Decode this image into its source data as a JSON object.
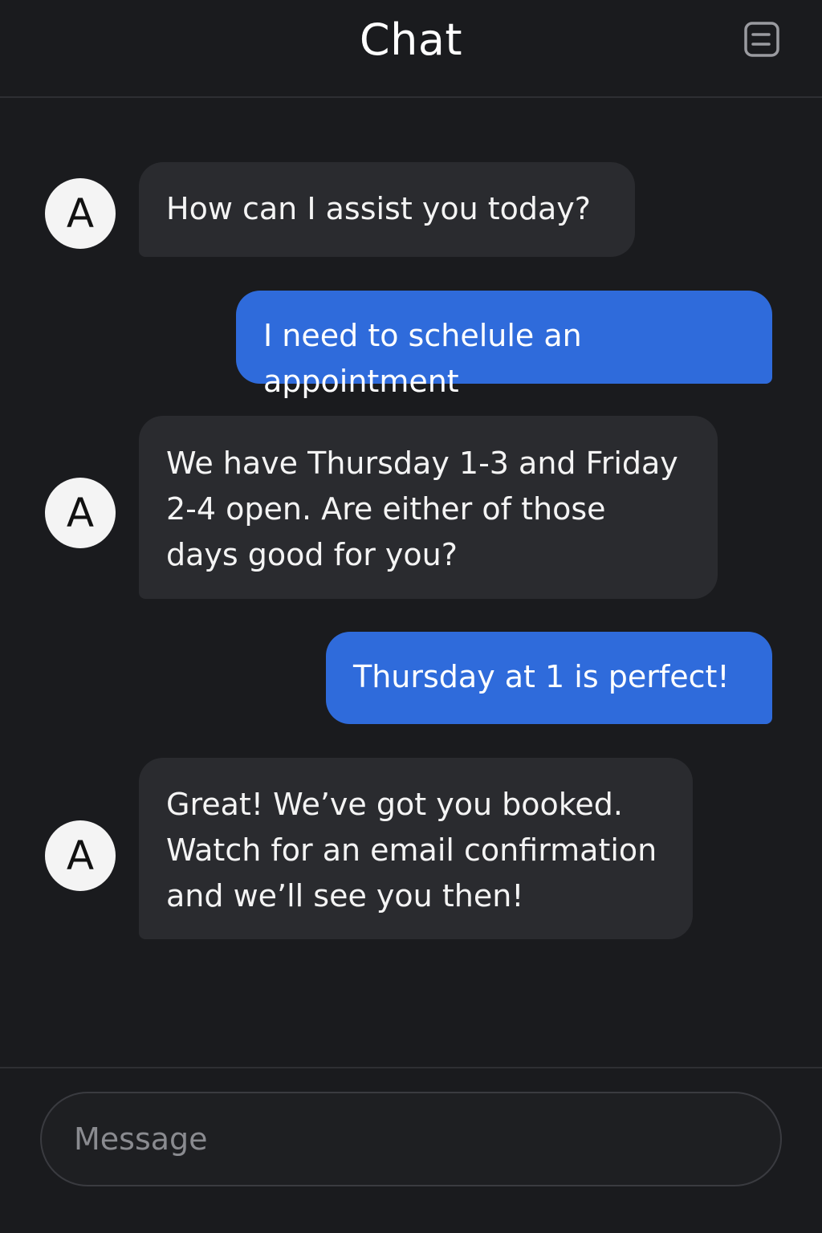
{
  "header": {
    "title": "Chat",
    "menu_icon": "list-menu-icon"
  },
  "messages": [
    {
      "sender": "assistant",
      "avatar": "A",
      "text": "How can I assist you today?"
    },
    {
      "sender": "user",
      "text": "I need to schelule an appointment"
    },
    {
      "sender": "assistant",
      "avatar": "A",
      "lines": [
        "We have Thursday 1-3 and Friday",
        "2-4 open. Are either of those",
        "days good for you?"
      ]
    },
    {
      "sender": "user",
      "text": "Thursday at 1 is perfect!"
    },
    {
      "sender": "assistant",
      "avatar": "A",
      "lines": [
        "Great! We’ve got you booked.",
        "Watch for an email confirmation",
        "and we’ll see you then!"
      ]
    }
  ],
  "composer": {
    "placeholder": "Message"
  },
  "colors": {
    "background": "#1a1b1e",
    "incoming_bubble": "#2a2b2f",
    "outgoing_bubble": "#2f6bdb",
    "avatar": "#f4f4f4"
  }
}
